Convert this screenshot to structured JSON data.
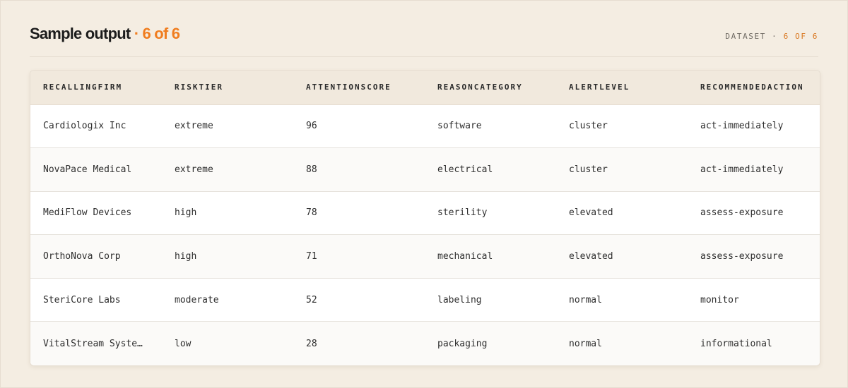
{
  "header": {
    "title": "Sample output",
    "title_accent": "· 6 of 6",
    "dataset_label": "DATASET ·",
    "dataset_count": "6 OF 6"
  },
  "table": {
    "columns": [
      "RECALLINGFIRM",
      "RISKTIER",
      "ATTENTIONSCORE",
      "REASONCATEGORY",
      "ALERTLEVEL",
      "RECOMMENDEDACTION"
    ],
    "rows": [
      [
        "Cardiologix Inc",
        "extreme",
        "96",
        "software",
        "cluster",
        "act-immediately"
      ],
      [
        "NovaPace Medical",
        "extreme",
        "88",
        "electrical",
        "cluster",
        "act-immediately"
      ],
      [
        "MediFlow Devices",
        "high",
        "78",
        "sterility",
        "elevated",
        "assess-exposure"
      ],
      [
        "OrthoNova Corp",
        "high",
        "71",
        "mechanical",
        "elevated",
        "assess-exposure"
      ],
      [
        "SteriCore Labs",
        "moderate",
        "52",
        "labeling",
        "normal",
        "monitor"
      ],
      [
        "VitalStream Syste…",
        "low",
        "28",
        "packaging",
        "normal",
        "informational"
      ]
    ]
  },
  "colors": {
    "accent": "#f07d1f",
    "background": "#f4ede2",
    "header_row": "#f1e9dd"
  }
}
